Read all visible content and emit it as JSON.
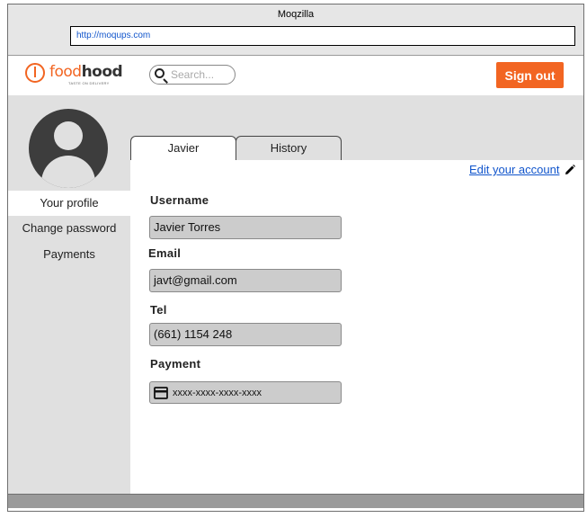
{
  "window": {
    "title": "Moqzilla",
    "url": "http://moqups.com"
  },
  "header": {
    "logo": {
      "word_food": "food",
      "word_hood": "hood",
      "tagline": "TASTE ON DELIVERY"
    },
    "search": {
      "placeholder": "Search..."
    },
    "signout_label": "Sign out",
    "accent_color": "#f26522"
  },
  "tabs": [
    {
      "label": "Javier",
      "active": true
    },
    {
      "label": "History",
      "active": false
    }
  ],
  "sidebar": {
    "items": [
      {
        "label": "Your profile",
        "active": true
      },
      {
        "label": "Change password",
        "active": false
      },
      {
        "label": "Payments",
        "active": false
      }
    ]
  },
  "profile": {
    "edit_link": "Edit your account",
    "username_label": "Username",
    "username_value": "Javier Torres",
    "email_label": "Email",
    "email_value": "javt@gmail.com",
    "tel_label": "Tel",
    "tel_value": "(661) 1154 248",
    "payment_label": "Payment",
    "payment_value": "xxxx-xxxx-xxxx-xxxx",
    "payment_icon": "credit-card-icon"
  }
}
